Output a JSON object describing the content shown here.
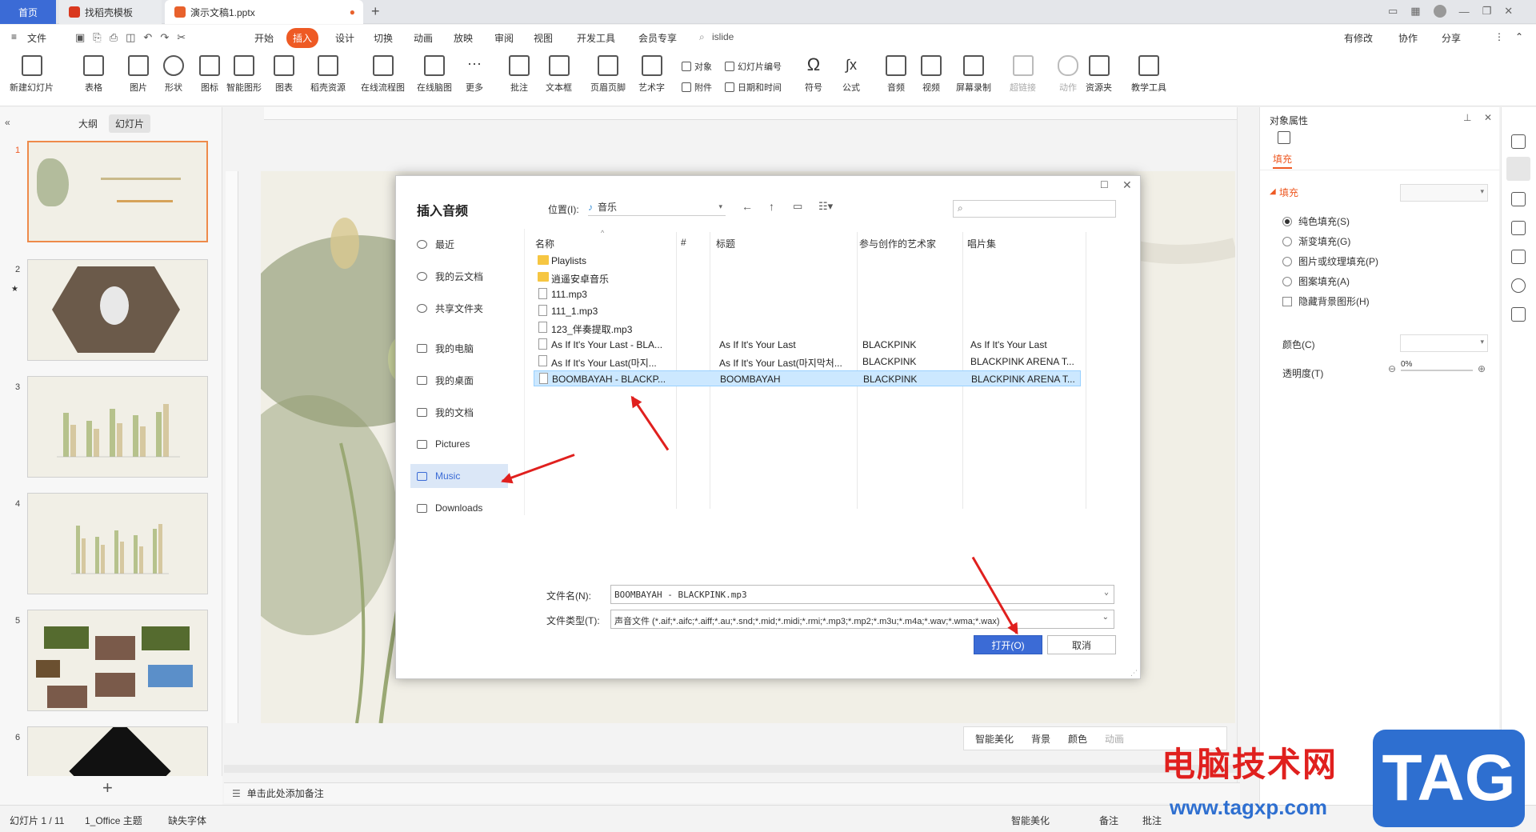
{
  "tabs": {
    "home": "首页",
    "template": "找稻壳模板",
    "doc": "演示文稿1.pptx",
    "add": "+"
  },
  "menubar": {
    "file": "文件",
    "items": [
      "开始",
      "插入",
      "设计",
      "切换",
      "动画",
      "放映",
      "审阅",
      "视图",
      "开发工具",
      "会员专享"
    ],
    "search": "islide",
    "right": [
      "有修改",
      "协作",
      "分享"
    ]
  },
  "ribbon": {
    "big": [
      "新建幻灯片",
      "表格",
      "图片",
      "形状",
      "图标",
      "智能图形",
      "图表",
      "稻壳资源",
      "在线流程图",
      "在线脑图",
      "更多",
      "批注",
      "文本框",
      "页眉页脚",
      "艺术字",
      "符号",
      "公式",
      "音频",
      "视频",
      "屏幕录制",
      "超链接",
      "动作",
      "资源夹",
      "教学工具"
    ],
    "small": [
      "对象",
      "幻灯片编号",
      "附件",
      "日期和时间"
    ]
  },
  "leftpanel": {
    "tab_outline": "大纲",
    "tab_slides": "幻灯片",
    "thumb_numbers": [
      "1",
      "2",
      "3",
      "4",
      "5",
      "6"
    ],
    "add": "+"
  },
  "notes": "单击此处添加备注",
  "canvas_toolbar": [
    "智能美化",
    "背景",
    "颜色",
    "动画"
  ],
  "dialog": {
    "title": "插入音频",
    "location_label": "位置(I):",
    "location_value": "音乐",
    "nav": [
      "最近",
      "我的云文档",
      "共享文件夹",
      "我的电脑",
      "我的桌面",
      "我的文档",
      "Pictures",
      "Music",
      "Downloads"
    ],
    "columns": [
      "名称",
      "#",
      "标题",
      "参与创作的艺术家",
      "唱片集"
    ],
    "rows": [
      {
        "type": "folder",
        "name": "Playlists",
        "title": "",
        "artist": "",
        "album": ""
      },
      {
        "type": "folder",
        "name": "逍遥安卓音乐",
        "title": "",
        "artist": "",
        "album": ""
      },
      {
        "type": "file",
        "name": "111.mp3",
        "title": "",
        "artist": "",
        "album": ""
      },
      {
        "type": "file",
        "name": "111_1.mp3",
        "title": "",
        "artist": "",
        "album": ""
      },
      {
        "type": "file",
        "name": "123_伴奏提取.mp3",
        "title": "",
        "artist": "",
        "album": ""
      },
      {
        "type": "file",
        "name": "As If It's Your Last - BLA...",
        "title": "As If It's Your Last",
        "artist": "BLACKPINK",
        "album": "As If It's Your Last"
      },
      {
        "type": "file",
        "name": "As If It's Your Last(마지...",
        "title": "As If It's Your Last(마지막처...",
        "artist": "BLACKPINK",
        "album": "BLACKPINK ARENA T..."
      },
      {
        "type": "file",
        "name": "BOOMBAYAH - BLACKP...",
        "title": "BOOMBAYAH",
        "artist": "BLACKPINK",
        "album": "BLACKPINK ARENA T..."
      }
    ],
    "filename_label": "文件名(N):",
    "filename_value": "BOOMBAYAH - BLACKPINK.mp3",
    "filetype_label": "文件类型(T):",
    "filetype_value": "声音文件 (*.aif;*.aifc;*.aiff;*.au;*.snd;*.mid;*.midi;*.rmi;*.mp3;*.mp2;*.m3u;*.m4a;*.wav;*.wma;*.wax)",
    "open": "打开(O)",
    "cancel": "取消"
  },
  "rightpanel": {
    "title": "对象属性",
    "tab_fill": "填充",
    "section_fill": "填充",
    "options": [
      "纯色填充(S)",
      "渐变填充(G)",
      "图片或纹理填充(P)",
      "图案填充(A)"
    ],
    "hide_bg": "隐藏背景图形(H)",
    "color_label": "颜色(C)",
    "transparency_label": "透明度(T)",
    "transparency_value": "0%"
  },
  "statusbar": {
    "slide": "幻灯片 1 / 11",
    "theme": "1_Office 主题",
    "font": "缺失字体",
    "beautify": "智能美化",
    "notes": "备注",
    "comment": "批注"
  },
  "watermark": {
    "text": "电脑技术网",
    "url": "www.tagxp.com",
    "badge": "TAG"
  },
  "colors": {
    "accent": "#3b6bd6",
    "insert_tab": "#ee5a24",
    "arrow": "#e0201e",
    "selection": "#cce8ff"
  }
}
